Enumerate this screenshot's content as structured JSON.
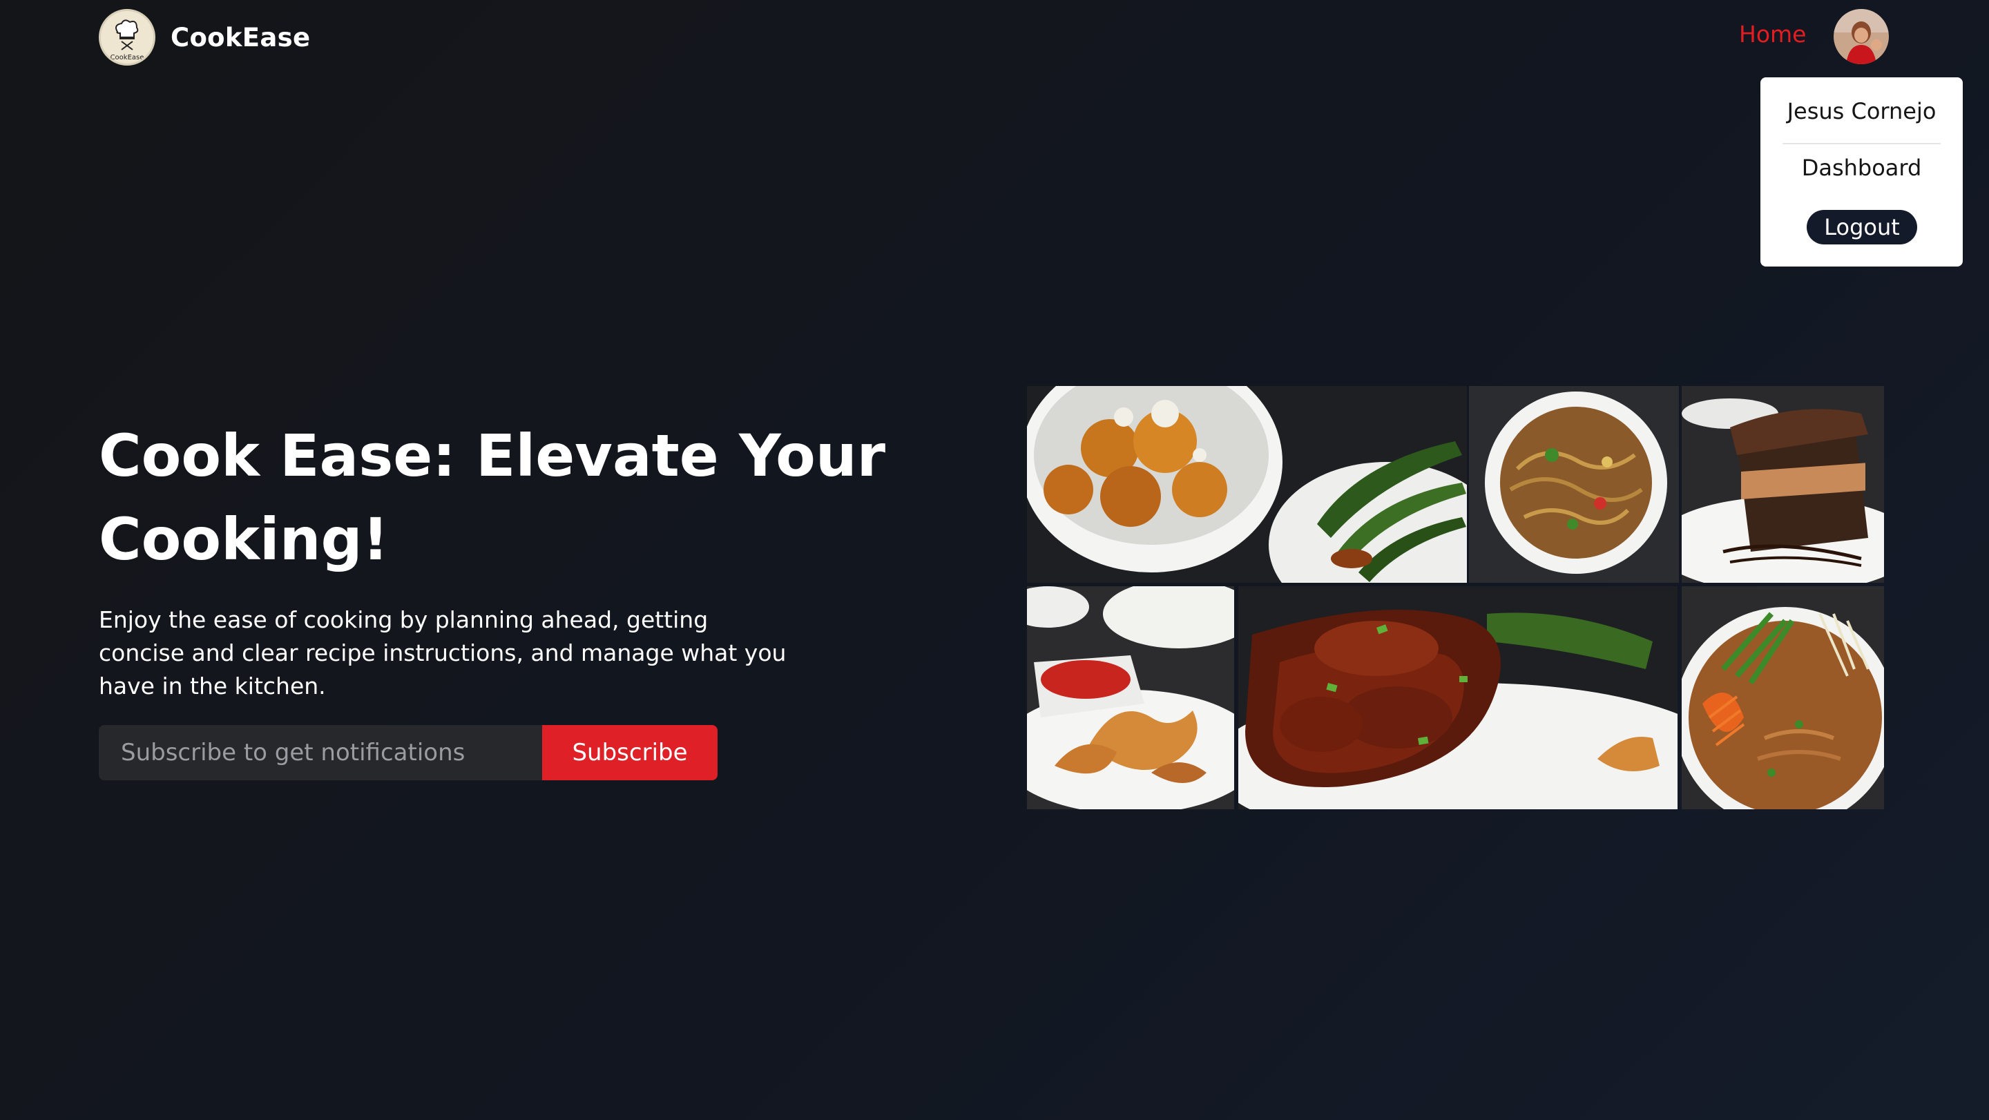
{
  "header": {
    "brand": "CookEase",
    "logo_text": "CookEase",
    "logo_icon": "chef-hat-icon",
    "nav_home": "Home",
    "avatar_icon": "user-avatar"
  },
  "dropdown": {
    "user_name": "Jesus Cornejo",
    "dashboard": "Dashboard",
    "logout": "Logout"
  },
  "hero": {
    "title_line1": "Cook Ease: Elevate Your",
    "title_line2": "Cooking!",
    "subtitle": "Enjoy the ease of cooking by planning ahead, getting concise and clear recipe instructions, and manage what you have in the kitchen.",
    "subscribe_placeholder": "Subscribe to get notifications",
    "subscribe_button": "Subscribe"
  },
  "gallery": {
    "items": [
      {
        "name": "coconut-chicken-and-green-beans-photo"
      },
      {
        "name": "noodles-bowl-photo"
      },
      {
        "name": "chocolate-cake-slice-photo"
      },
      {
        "name": "wontons-with-sauce-photo"
      },
      {
        "name": "glazed-ribs-photo"
      },
      {
        "name": "pad-thai-photo"
      }
    ]
  },
  "colors": {
    "accent": "#e41d22",
    "button": "#df2127",
    "background": "#121620",
    "input_bg": "#27282b",
    "logout_bg": "#131a2a"
  }
}
